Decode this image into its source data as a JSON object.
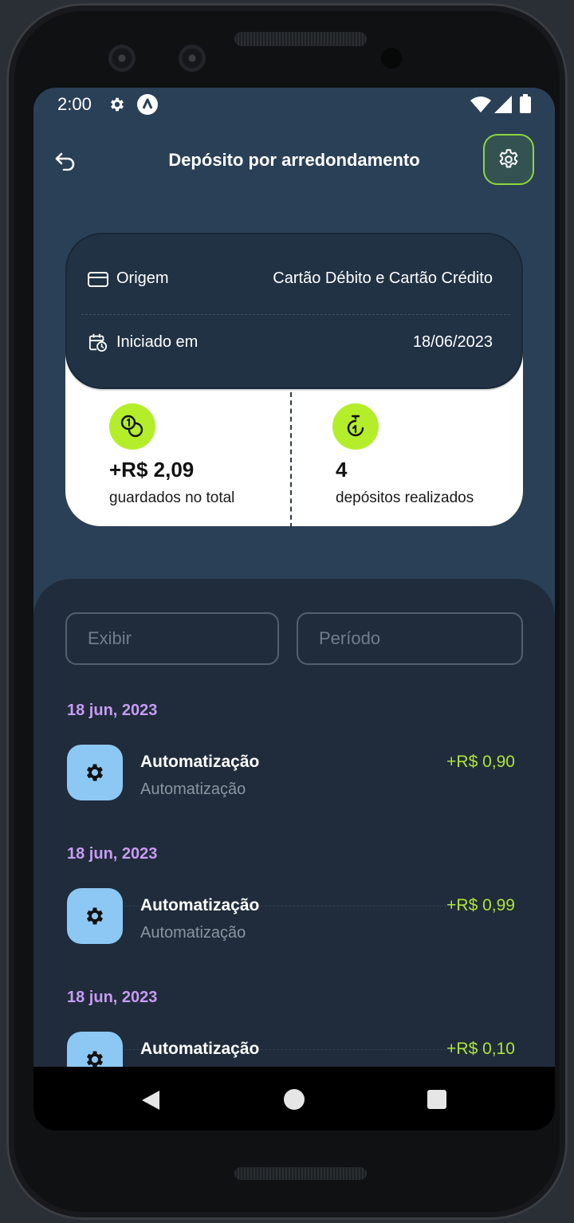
{
  "status_bar": {
    "time": "2:00",
    "icons": [
      "gear-icon",
      "a-circle-icon",
      "wifi-icon",
      "signal-icon",
      "battery-icon"
    ]
  },
  "header": {
    "title": "Depósito por arredondamento",
    "back_icon": "back-arrow-icon",
    "settings_icon": "gear-icon"
  },
  "summary": {
    "origin_label": "Origem",
    "origin_value": "Cartão Débito e Cartão Crédito",
    "start_label": "Iniciado em",
    "start_value": "18/06/2023",
    "total_value": "+R$ 2,09",
    "total_label": "guardados no total",
    "count_value": "4",
    "count_label": "depósitos realizados"
  },
  "filters": {
    "show_placeholder": "Exibir",
    "period_placeholder": "Período"
  },
  "transactions": [
    {
      "date": "18 jun, 2023",
      "title": "Automatização",
      "subtitle": "Automatização",
      "amount": "+R$ 0,90"
    },
    {
      "date": "18 jun, 2023",
      "title": "Automatização",
      "subtitle": "Automatização",
      "amount": "+R$ 0,99"
    },
    {
      "date": "18 jun, 2023",
      "title": "Automatização",
      "subtitle": "",
      "amount": "+R$ 0,10"
    }
  ],
  "colors": {
    "accent_green": "#b4ee2a",
    "amount_green": "#aee43a",
    "date_purple": "#c89cf3",
    "screen_bg": "#2a4057",
    "panel_bg": "#202c3b"
  }
}
